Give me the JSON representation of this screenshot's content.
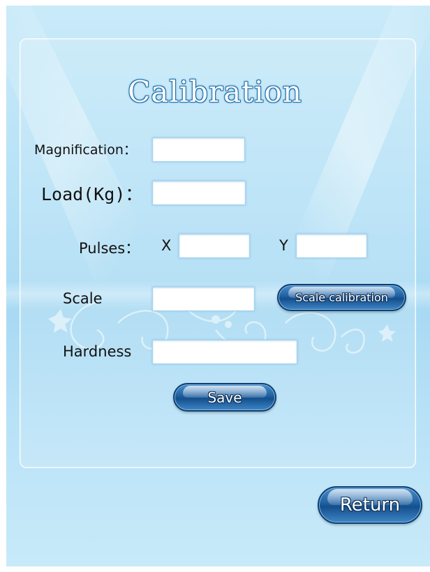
{
  "page": {
    "title": "Calibration"
  },
  "fields": {
    "magnification": {
      "label": "Magnification：",
      "value": ""
    },
    "load": {
      "label": "Load(Kg)：",
      "value": ""
    },
    "pulses": {
      "label": "Pulses：",
      "x_label": "X",
      "y_label": "Y",
      "x_value": "",
      "y_value": ""
    },
    "scale": {
      "label": "Scale",
      "value": ""
    },
    "hardness": {
      "label": "Hardness",
      "value": ""
    }
  },
  "buttons": {
    "scale_calibration": "Scale calibration",
    "save": "Save",
    "return": "Return"
  },
  "colors": {
    "accent": "#1f5f9f",
    "background": "#b5e1f6",
    "title_outline": "#1d6aa6"
  }
}
